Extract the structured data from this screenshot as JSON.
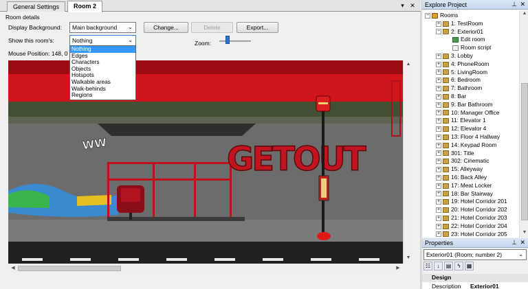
{
  "tabs": [
    {
      "label": "General Settings"
    },
    {
      "label": "Room 2"
    }
  ],
  "room_details": {
    "section_label": "Room details",
    "display_background_label": "Display Background:",
    "display_background_value": "Main background",
    "show_label": "Show this room's:",
    "show_value": "Nothing",
    "mouse_position": "Mouse Position: 148, 0",
    "zoom_label": "Zoom:",
    "zoom_level_fraction": 0.25,
    "change_button": "Change...",
    "delete_button": "Delete",
    "export_button": "Export...",
    "show_options": [
      "Nothing",
      "Edges",
      "Characters",
      "Objects",
      "Hotspots",
      "Walkable areas",
      "Walk-behinds",
      "Regions"
    ],
    "selected_option_index": 0
  },
  "scene": {
    "graffiti_text": "GETOUT",
    "sky_color": "#c8101a",
    "wall_color": "#6c6c6c"
  },
  "explore": {
    "title": "Explore Project",
    "tree": [
      {
        "label": "Rooms",
        "level": 0,
        "expanded": true,
        "icon": "rooms-icon"
      },
      {
        "label": "1: TestRoom",
        "level": 1,
        "icon": "room-icon"
      },
      {
        "label": "2: Exterior01",
        "level": 1,
        "expanded": true,
        "icon": "room-icon"
      },
      {
        "label": "Edit room",
        "level": 2,
        "icon": "edit-room-icon"
      },
      {
        "label": "Room script",
        "level": 2,
        "icon": "script-icon"
      },
      {
        "label": "3: Lobby",
        "level": 1,
        "icon": "room-icon"
      },
      {
        "label": "4: PhoneRoom",
        "level": 1,
        "icon": "room-icon"
      },
      {
        "label": "5: LivingRoom",
        "level": 1,
        "icon": "room-icon"
      },
      {
        "label": "6: Bedroom",
        "level": 1,
        "icon": "room-icon"
      },
      {
        "label": "7: Bathroom",
        "level": 1,
        "icon": "room-icon"
      },
      {
        "label": "8: Bar",
        "level": 1,
        "icon": "room-icon"
      },
      {
        "label": "9: Bar Bathroom",
        "level": 1,
        "icon": "room-icon"
      },
      {
        "label": "10: Manager Office",
        "level": 1,
        "icon": "room-icon"
      },
      {
        "label": "11: Elevator 1",
        "level": 1,
        "icon": "room-icon"
      },
      {
        "label": "12: Elevator 4",
        "level": 1,
        "icon": "room-icon"
      },
      {
        "label": "13: Floor 4 Hallway",
        "level": 1,
        "icon": "room-icon"
      },
      {
        "label": "14: Keypad Room",
        "level": 1,
        "icon": "room-icon"
      },
      {
        "label": "301: Title",
        "level": 1,
        "icon": "room-icon"
      },
      {
        "label": "302: Cinematic",
        "level": 1,
        "icon": "room-icon"
      },
      {
        "label": "15: Alleyway",
        "level": 1,
        "icon": "room-icon"
      },
      {
        "label": "16: Back Alley",
        "level": 1,
        "icon": "room-icon"
      },
      {
        "label": "17: Meat Locker",
        "level": 1,
        "icon": "room-icon"
      },
      {
        "label": "18: Bar Stairway",
        "level": 1,
        "icon": "room-icon"
      },
      {
        "label": "19: Hotel Corridor 201",
        "level": 1,
        "icon": "room-icon"
      },
      {
        "label": "20: Hotel Corridor 202",
        "level": 1,
        "icon": "room-icon"
      },
      {
        "label": "21: Hotel Corridor 203",
        "level": 1,
        "icon": "room-icon"
      },
      {
        "label": "22: Hotel Corridor 204",
        "level": 1,
        "icon": "room-icon"
      },
      {
        "label": "23: Hotel Corridor 205",
        "level": 1,
        "icon": "room-icon"
      }
    ]
  },
  "properties": {
    "title": "Properties",
    "object_label": "Exterior01 (Room; number 2)",
    "category": "Design",
    "row_key": "Description",
    "row_value": "Exterior01"
  }
}
